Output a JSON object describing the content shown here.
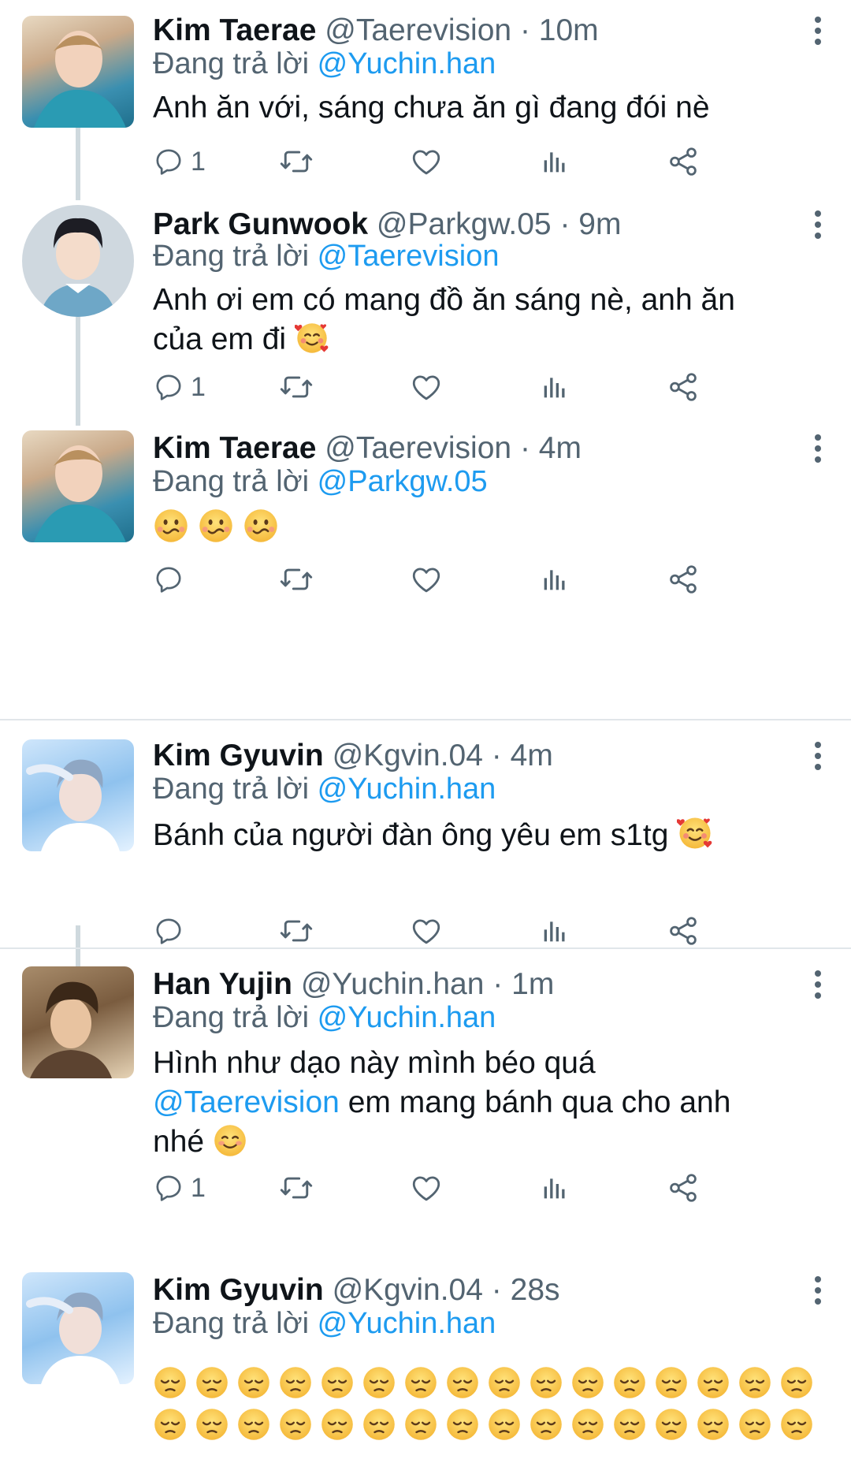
{
  "reply_prefix": "Đang trả lời",
  "tweets": [
    {
      "name": "Kim Taerae",
      "handle": "@Taerevision",
      "sep": "·",
      "time": "10m",
      "reply_to": "@Yuchin.han",
      "text": "Anh ăn với, sáng chưa ăn gì đang đói nè",
      "reply_count": "1"
    },
    {
      "name": "Park Gunwook",
      "handle": "@Parkgw.05",
      "sep": "·",
      "time": "9m",
      "reply_to": "@Taerevision",
      "text_line1": "Anh ơi em có mang đồ ăn sáng nè, anh ăn",
      "text_line2": "của em đi",
      "reply_count": "1"
    },
    {
      "name": "Kim Taerae",
      "handle": "@Taerevision",
      "sep": "·",
      "time": "4m",
      "reply_to": "@Parkgw.05",
      "reply_count": ""
    },
    {
      "name": "Kim Gyuvin",
      "handle": "@Kgvin.04",
      "sep": "·",
      "time": "4m",
      "reply_to": "@Yuchin.han",
      "text": "Bánh của người đàn ông yêu em s1tg",
      "reply_count": ""
    },
    {
      "name": "Han Yujin",
      "handle": "@Yuchin.han",
      "sep": "·",
      "time": "1m",
      "reply_to": "@Yuchin.han",
      "text_line1": "Hình như dạo này mình béo quá",
      "mention": "@Taerevision",
      "text_line2_rest": " em mang bánh qua cho anh",
      "text_line3": "nhé",
      "reply_count": "1"
    },
    {
      "name": "Kim Gyuvin",
      "handle": "@Kgvin.04",
      "sep": "·",
      "time": "28s",
      "reply_to": "@Yuchin.han",
      "reply_count": ""
    }
  ],
  "colors": {
    "link": "#1d9bf0",
    "muted": "#536471",
    "divider": "#e1e6ea",
    "thread_line": "#cfd9de"
  },
  "icons": [
    "reply-icon",
    "retweet-icon",
    "like-icon",
    "views-icon",
    "share-icon",
    "more-icon"
  ]
}
